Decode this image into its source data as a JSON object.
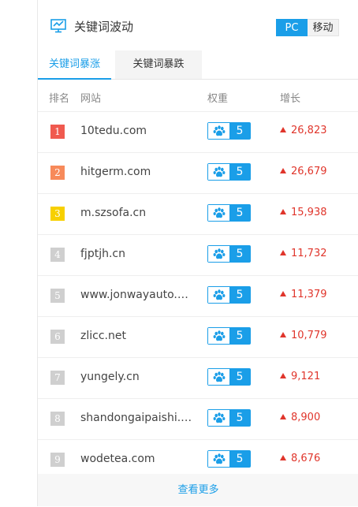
{
  "header": {
    "title": "关键词波动",
    "toggle": {
      "pc_label": "PC",
      "mobile_label": "移动"
    }
  },
  "tabs": [
    {
      "label": "关键词暴涨",
      "active": true
    },
    {
      "label": "关键词暴跌",
      "active": false
    }
  ],
  "table": {
    "columns": [
      "排名",
      "网站",
      "权重",
      "增长"
    ],
    "rows": [
      {
        "rank": "1",
        "site": "10tedu.com",
        "weight": "5",
        "growth": "26,823"
      },
      {
        "rank": "2",
        "site": "hitgerm.com",
        "weight": "5",
        "growth": "26,679"
      },
      {
        "rank": "3",
        "site": "m.szsofa.cn",
        "weight": "5",
        "growth": "15,938"
      },
      {
        "rank": "4",
        "site": "fjptjh.cn",
        "weight": "5",
        "growth": "11,732"
      },
      {
        "rank": "5",
        "site": "www.jonwayauto.c...",
        "weight": "5",
        "growth": "11,379"
      },
      {
        "rank": "6",
        "site": "zlicc.net",
        "weight": "5",
        "growth": "10,779"
      },
      {
        "rank": "7",
        "site": "yungely.cn",
        "weight": "5",
        "growth": "9,121"
      },
      {
        "rank": "8",
        "site": "shandongaipaishi.cn",
        "weight": "5",
        "growth": "8,900"
      },
      {
        "rank": "9",
        "site": "wodetea.com",
        "weight": "5",
        "growth": "8,676"
      }
    ]
  },
  "footer": {
    "more_label": "查看更多"
  },
  "colors": {
    "accent": "#1a9ee8",
    "rank1": "#f05a4f",
    "rank2": "#f78a5a",
    "rank3": "#f7d000",
    "rank_other": "#cfcfcf",
    "growth_up": "#e0352b"
  },
  "icons": {
    "header": "chart-monitor-icon",
    "weight": "baidu-paw-icon",
    "growth": "triangle-up-icon"
  }
}
